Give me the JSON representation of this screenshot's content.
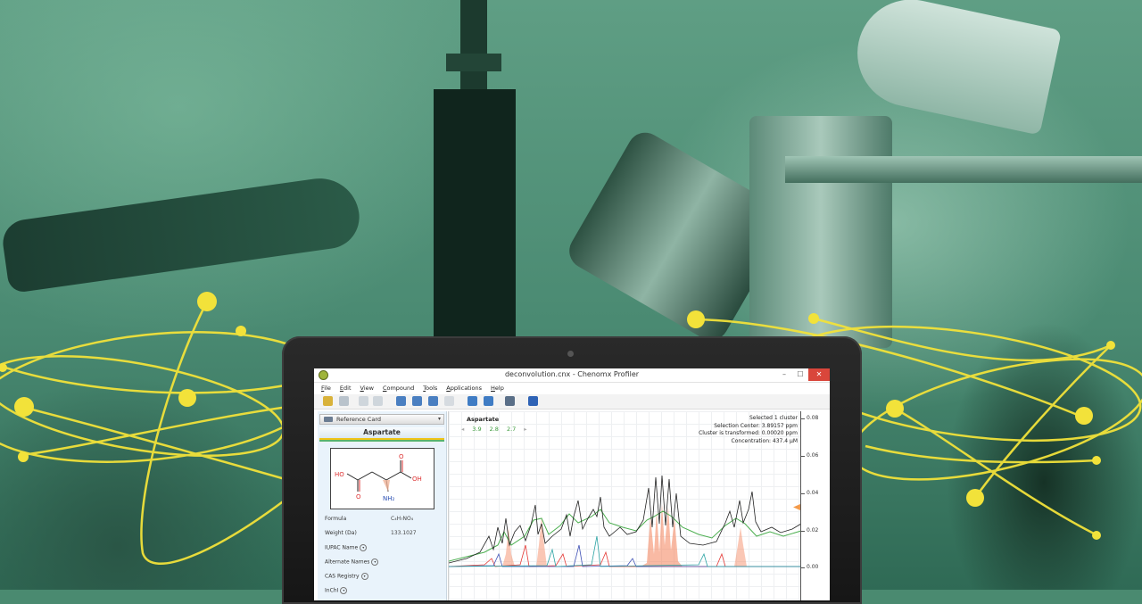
{
  "window": {
    "title": "deconvolution.cnx - Chenomx Profiler",
    "controls": {
      "minimize": "–",
      "maximize": "☐",
      "close": "✕"
    }
  },
  "menu": [
    "File",
    "Edit",
    "View",
    "Compound",
    "Tools",
    "Applications",
    "Help"
  ],
  "toolbar": {
    "buttons": [
      {
        "name": "open-icon",
        "color": "#d9b23a"
      },
      {
        "name": "save-icon",
        "color": "#b9c3cc"
      },
      {
        "name": "undo-icon",
        "color": "#cfd6dc"
      },
      {
        "name": "redo-icon",
        "color": "#cfd6dc"
      },
      {
        "name": "zoom-in-icon",
        "color": "#4a7fc1"
      },
      {
        "name": "zoom-out-icon",
        "color": "#4a7fc1"
      },
      {
        "name": "zoom-fit-icon",
        "color": "#4a7fc1"
      },
      {
        "name": "zoom-reset-icon",
        "color": "#d6dbe0"
      },
      {
        "name": "cluster-remove-icon",
        "color": "#3f7cc4"
      },
      {
        "name": "panel-layout-icon",
        "color": "#3f7cc4"
      },
      {
        "name": "columns-icon",
        "color": "#5a6f88"
      },
      {
        "name": "profile-run-icon",
        "color": "#2f63b6"
      }
    ]
  },
  "left_panel": {
    "dropdown_label": "Reference Card",
    "compound_name": "Aspartate",
    "structure_labels": {
      "ho": "HO",
      "oh": "OH",
      "o1": "O",
      "o2": "O",
      "nh2": "NH₂"
    },
    "properties": [
      {
        "label": "Formula",
        "value": "C₄H₇NO₄"
      },
      {
        "label": "Weight (Da)",
        "value": "133.1027"
      }
    ],
    "expandables": [
      "IUPAC Name",
      "Alternate Names",
      "CAS Registry",
      "InChI"
    ]
  },
  "spectrum": {
    "compound": "Aspartate",
    "shifts": [
      "3.9",
      "2.8",
      "2.7"
    ],
    "info": [
      "Selected 1 cluster",
      "Selection Center: 3.89157 ppm",
      "Cluster is transformed: 0.00020 ppm",
      "Concentration: 437.4 μM"
    ],
    "y_ticks": [
      "0.08",
      "0.06",
      "0.04",
      "0.02",
      "0.00"
    ],
    "colors": {
      "sum": "#222222",
      "fit": "#4caf50",
      "selected": "#f4825a",
      "compound_a": "#e53935",
      "compound_b": "#3f51b5",
      "compound_c": "#2aa3a3"
    }
  }
}
